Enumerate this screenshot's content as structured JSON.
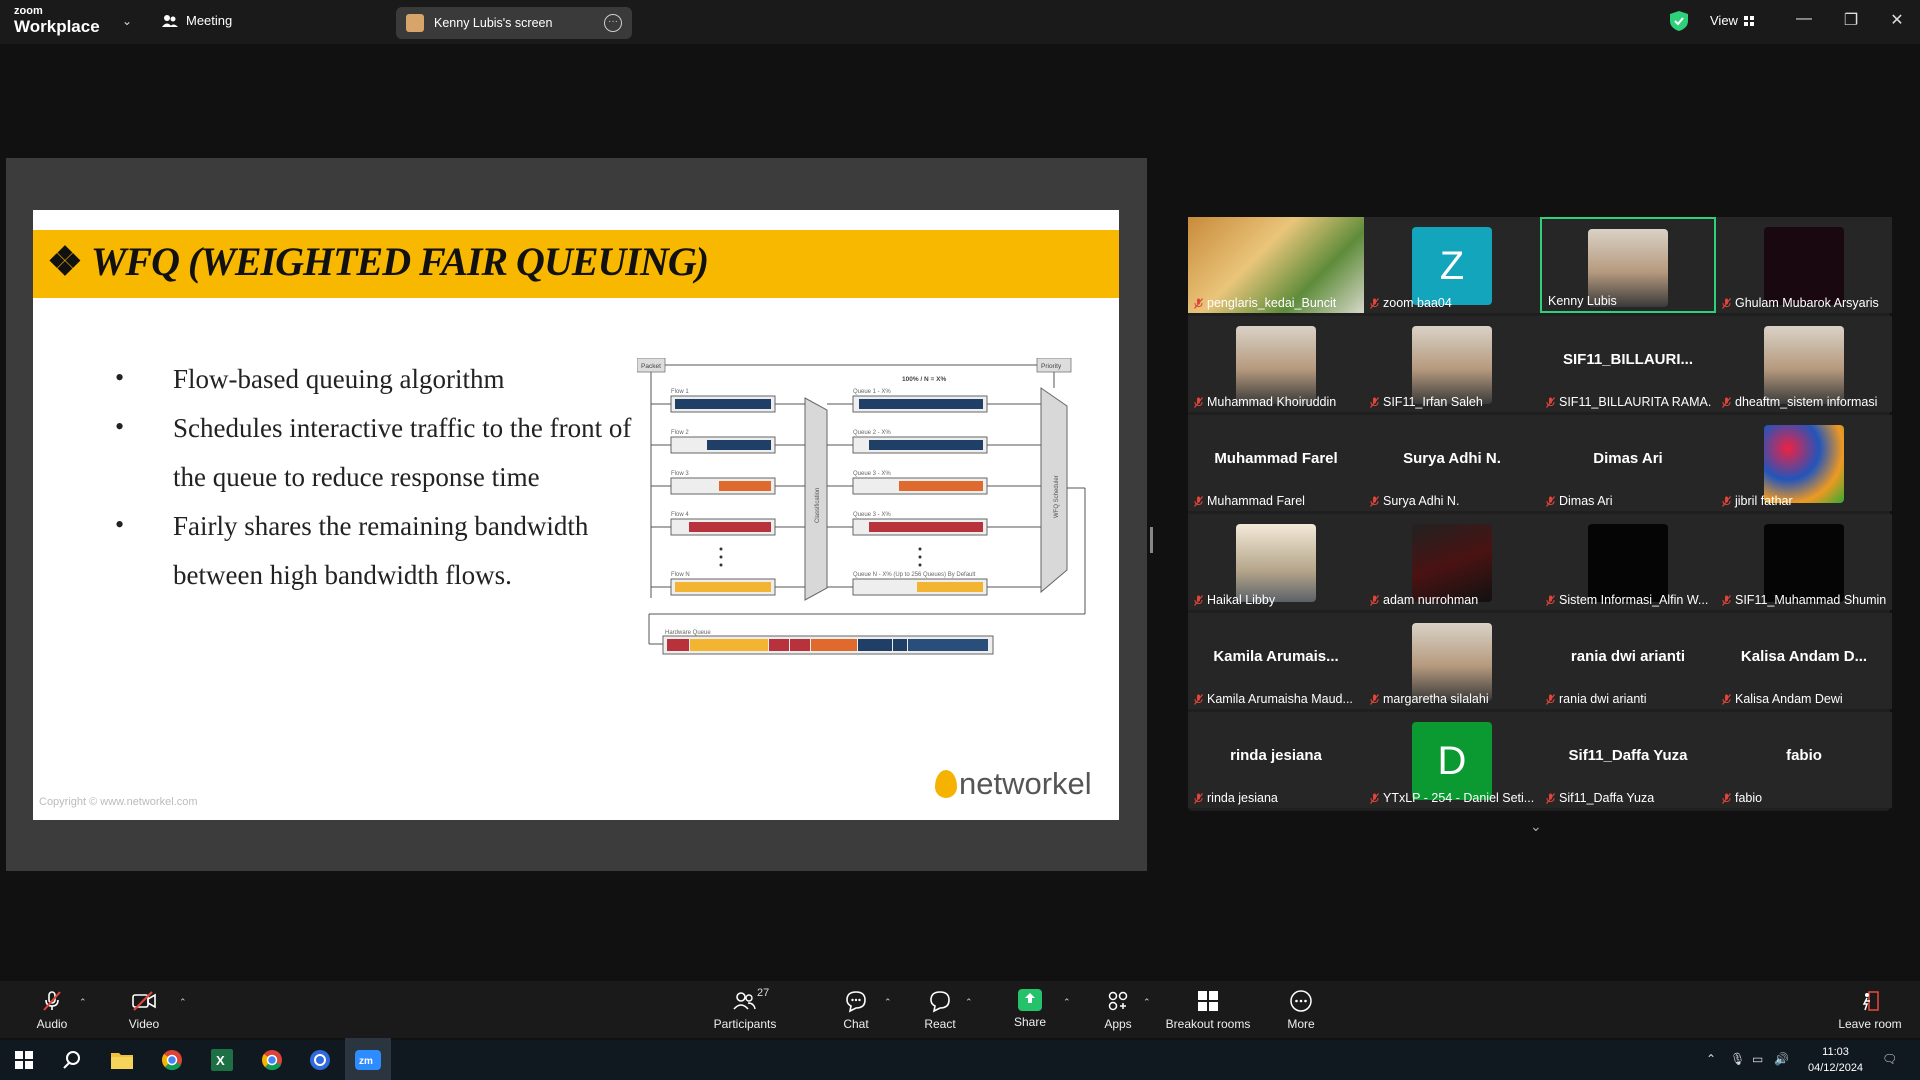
{
  "app": {
    "brand_top": "zoom",
    "brand_bottom": "Workplace",
    "meeting_label": "Meeting",
    "screen_label": "Kenny Lubis's screen",
    "view_label": "View"
  },
  "slide": {
    "title": "WFQ (WEIGHTED FAIR QUEUING)",
    "bullets": [
      "Flow-based queuing algorithm",
      "Schedules interactive traffic to the front of the queue to reduce response time",
      "Fairly shares the remaining bandwidth between high bandwidth flows."
    ],
    "copyright": "Copyright © www.networkel.com",
    "logo_text": "networkel",
    "diagram": {
      "packet": "Packet",
      "priority": "Priority",
      "ratio": "100% / N = X%",
      "flows": [
        "Flow 1",
        "Flow 2",
        "Flow 3",
        "Flow 4",
        "Flow N"
      ],
      "queues": [
        "Queue 1 - X%",
        "Queue 2 - X%",
        "Queue 3 - X%",
        "Queue 3 - X%",
        "Queue N - X% (Up to 256 Queues) By Default"
      ],
      "classification": "Classification",
      "scheduler": "WFQ Scheduler",
      "hardware_queue": "Hardware Queue"
    }
  },
  "participants": [
    {
      "big": "",
      "name": "penglaris_kedai_Buncit",
      "thumb": "food"
    },
    {
      "big": "",
      "name": "zoom baa04",
      "thumb": "letter",
      "letter": "Z",
      "color": "#13a5bc"
    },
    {
      "big": "",
      "name": "Kenny Lubis",
      "thumb": "photo",
      "active": true
    },
    {
      "big": "",
      "name": "Ghulam Mubarok Arsyaris",
      "thumb": "dark"
    },
    {
      "big": "",
      "name": "Muhammad Khoiruddin",
      "thumb": "photo"
    },
    {
      "big": "",
      "name": "SIF11_Irfan Saleh",
      "thumb": "photo"
    },
    {
      "big": "SIF11_BILLAURI...",
      "name": "SIF11_BILLAURITA RAMA...",
      "thumb": "none"
    },
    {
      "big": "",
      "name": "dheaftm_sistem informasi",
      "thumb": "photo"
    },
    {
      "big": "Muhammad Farel",
      "name": "Muhammad Farel",
      "thumb": "none"
    },
    {
      "big": "Surya Adhi N.",
      "name": "Surya Adhi N.",
      "thumb": "none"
    },
    {
      "big": "Dimas Ari",
      "name": "Dimas Ari",
      "thumb": "none"
    },
    {
      "big": "",
      "name": "jibril fathar",
      "thumb": "art"
    },
    {
      "big": "",
      "name": "Haikal Libby",
      "thumb": "cat"
    },
    {
      "big": "",
      "name": "adam nurrohman",
      "thumb": "dark2"
    },
    {
      "big": "",
      "name": "Sistem Informasi_Alfin W...",
      "thumb": "black"
    },
    {
      "big": "",
      "name": "SIF11_Muhammad Shumin",
      "thumb": "black"
    },
    {
      "big": "Kamila  Arumais...",
      "name": "Kamila Arumaisha Maud...",
      "thumb": "none"
    },
    {
      "big": "",
      "name": "margaretha silalahi",
      "thumb": "photo"
    },
    {
      "big": "rania dwi arianti",
      "name": "rania dwi arianti",
      "thumb": "none"
    },
    {
      "big": "Kalisa Andam D...",
      "name": "Kalisa Andam Dewi",
      "thumb": "none"
    },
    {
      "big": "rinda jesiana",
      "name": "rinda jesiana",
      "thumb": "none"
    },
    {
      "big": "",
      "name": "YTxLP - 254 - Daniel Seti...",
      "thumb": "letter",
      "letter": "D",
      "color": "#0b9a32"
    },
    {
      "big": "Sif11_Daffa Yuza",
      "name": "Sif11_Daffa Yuza",
      "thumb": "none"
    },
    {
      "big": "fabio",
      "name": "fabio",
      "thumb": "none"
    }
  ],
  "toolbar": {
    "audio": "Audio",
    "video": "Video",
    "participants": "Participants",
    "participants_count": "27",
    "chat": "Chat",
    "react": "React",
    "share": "Share",
    "apps": "Apps",
    "breakout": "Breakout rooms",
    "more": "More",
    "leave": "Leave room"
  },
  "taskbar": {
    "time": "11:03",
    "date": "04/12/2024"
  },
  "colors": {
    "accent_green": "#2ed07a",
    "share_green": "#24c26a",
    "slide_header": "#f8b800",
    "mic_off": "#e0453a"
  }
}
